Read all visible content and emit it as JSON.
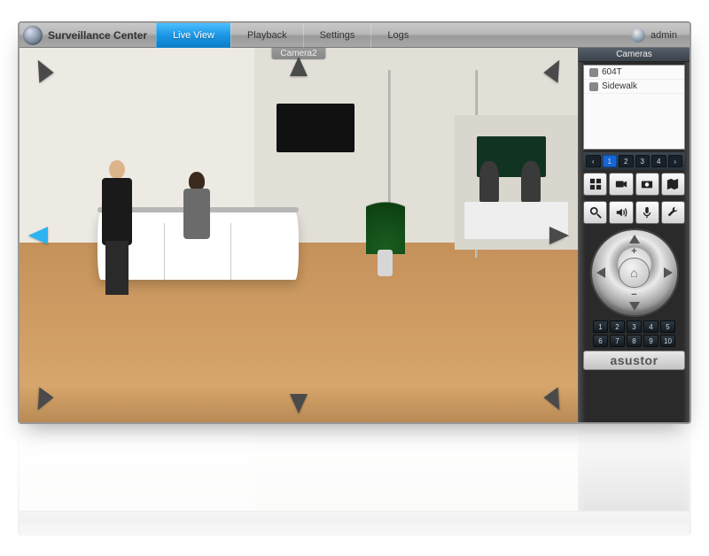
{
  "app_title": "Surveillance Center",
  "tabs": {
    "live": "Live View",
    "playback": "Playback",
    "settings": "Settings",
    "logs": "Logs"
  },
  "user": {
    "name": "admin"
  },
  "camera_label": "Camera2",
  "sidepanel": {
    "header": "Cameras",
    "cameras": [
      {
        "name": "604T"
      },
      {
        "name": "Sidewalk"
      }
    ],
    "layouts": [
      "1",
      "2",
      "3",
      "4"
    ],
    "presets": [
      "1",
      "2",
      "3",
      "4",
      "5",
      "6",
      "7",
      "8",
      "9",
      "10"
    ],
    "brand": "asustor",
    "home_glyph": "⌂",
    "zoom_in": "+",
    "zoom_out": "−"
  }
}
